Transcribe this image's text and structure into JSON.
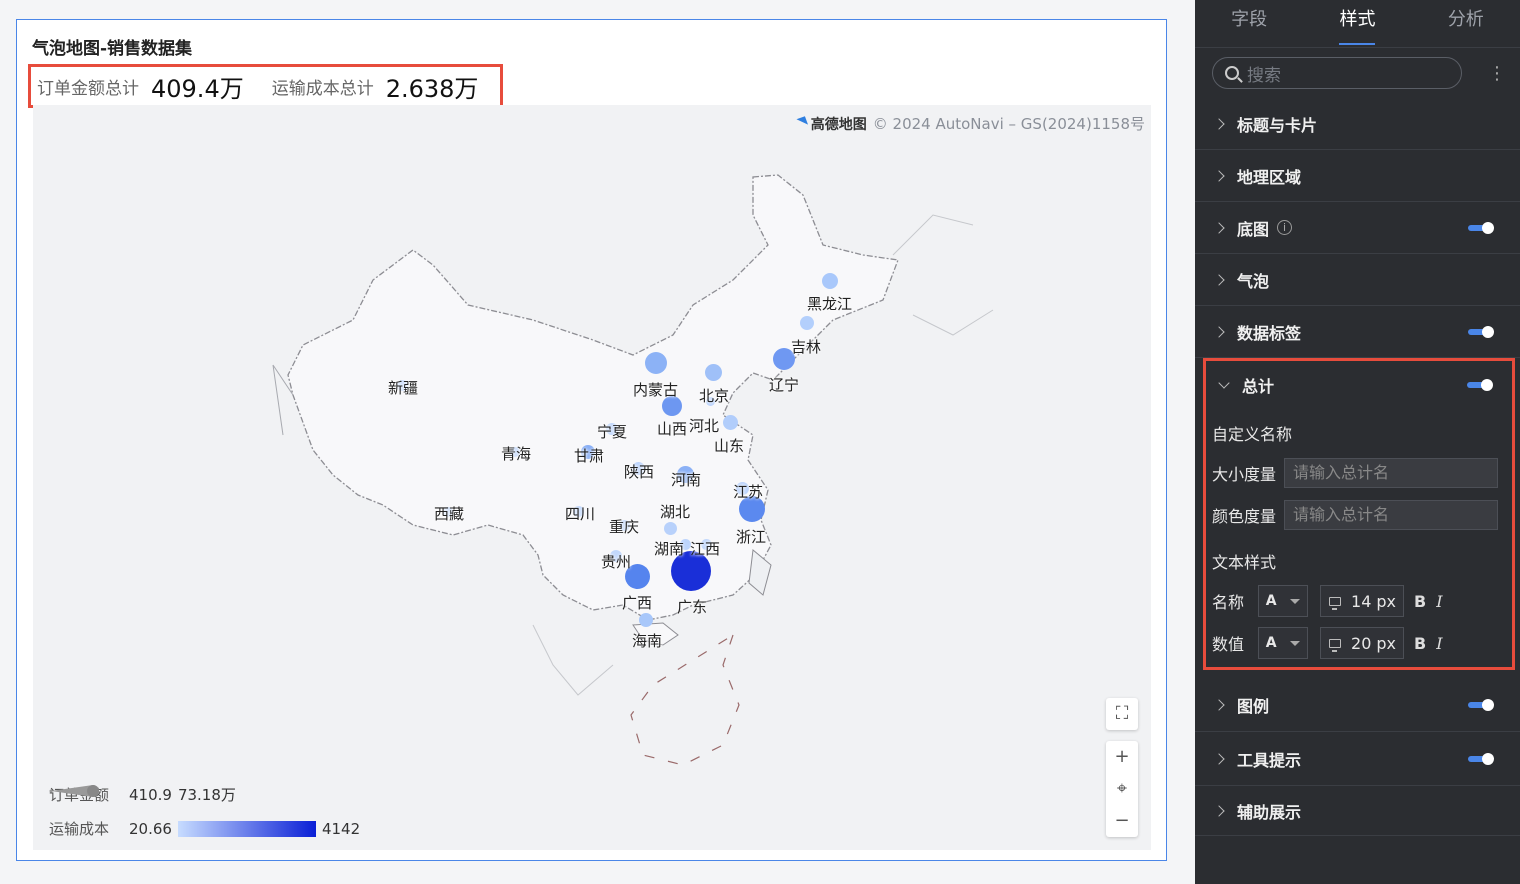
{
  "chart_title": "气泡地图-销售数据集",
  "totals": [
    {
      "name": "订单金额总计",
      "value": "409.4万"
    },
    {
      "name": "运输成本总计",
      "value": "2.638万"
    }
  ],
  "map": {
    "attribution_logo": "高德地图",
    "attribution_text": "© 2024 AutoNavi – GS(2024)1158号",
    "controls": {
      "fullscreen": "⛶",
      "zoom_in": "+",
      "locate": "⌖",
      "zoom_out": "−"
    }
  },
  "provinces": [
    {
      "name": "黑龙江"
    },
    {
      "name": "吉林"
    },
    {
      "name": "辽宁"
    },
    {
      "name": "内蒙古"
    },
    {
      "name": "北京"
    },
    {
      "name": "河北"
    },
    {
      "name": "山西"
    },
    {
      "name": "山东"
    },
    {
      "name": "宁夏"
    },
    {
      "name": "甘肃"
    },
    {
      "name": "陕西"
    },
    {
      "name": "河南"
    },
    {
      "name": "江苏"
    },
    {
      "name": "新疆"
    },
    {
      "name": "青海"
    },
    {
      "name": "西藏"
    },
    {
      "name": "四川"
    },
    {
      "name": "重庆"
    },
    {
      "name": "湖北"
    },
    {
      "name": "浙江"
    },
    {
      "name": "湖南"
    },
    {
      "name": "江西"
    },
    {
      "name": "贵州"
    },
    {
      "name": "广西"
    },
    {
      "name": "广东"
    },
    {
      "name": "海南"
    }
  ],
  "legend": {
    "size": {
      "name": "订单金额",
      "min": "410.9",
      "max": "73.18万"
    },
    "color": {
      "name": "运输成本",
      "min": "20.66",
      "max": "4142",
      "color_min": "#c7dcff",
      "color_max": "#0a1fd6"
    }
  },
  "panel": {
    "tabs": [
      {
        "label": "字段"
      },
      {
        "label": "样式"
      },
      {
        "label": "分析"
      }
    ],
    "active_tab": "样式",
    "search_placeholder": "搜索",
    "sections_top": [
      {
        "label": "标题与卡片",
        "toggle": false
      },
      {
        "label": "地理区域",
        "toggle": false
      },
      {
        "label": "底图",
        "toggle": true,
        "info": true
      },
      {
        "label": "气泡",
        "toggle": false
      },
      {
        "label": "数据标签",
        "toggle": true
      }
    ],
    "total_section": {
      "label": "总计",
      "custom_name_label": "自定义名称",
      "size_measure_label": "大小度量",
      "size_measure_placeholder": "请输入总计名",
      "color_measure_label": "颜色度量",
      "color_measure_placeholder": "请输入总计名",
      "text_style_label": "文本样式",
      "name_row": {
        "label": "名称",
        "font": "A",
        "size": "14",
        "unit": "px",
        "bold": "B",
        "italic": "I"
      },
      "value_row": {
        "label": "数值",
        "font": "A",
        "size": "20",
        "unit": "px",
        "bold": "B",
        "italic": "I"
      }
    },
    "sections_bottom": [
      {
        "label": "图例",
        "toggle": true
      },
      {
        "label": "工具提示",
        "toggle": true
      },
      {
        "label": "辅助展示",
        "toggle": false
      }
    ]
  },
  "colors": {
    "accent": "#4a86e8",
    "highlight_border": "#e74c3c",
    "panel_bg": "#2b2d31"
  }
}
